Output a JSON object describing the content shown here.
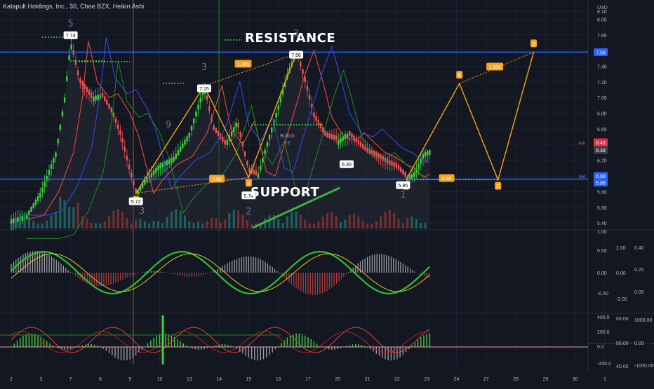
{
  "header": {
    "title": "Katapult Holdings, Inc., 30, Cboe BZX, Heikin Ashi",
    "currency": "USD"
  },
  "annotations": {
    "resistance": "RESISTANCE",
    "support": "SUPPORT",
    "bullish": "Bullish",
    "bullish_score": "+2"
  },
  "colors": {
    "background": "#131722",
    "up": "#26a69a",
    "green": "#3cd23c",
    "down": "#ef5350",
    "level_line": "#2962ff",
    "pattern": "#f7a21b",
    "grid": "#1e2230"
  },
  "chart_data": [
    {
      "type": "line",
      "name": "price",
      "style": "heikin_ashi_candles",
      "x_ticks": [
        "2",
        "3",
        "7",
        "8",
        "9",
        "10",
        "13",
        "14",
        "15",
        "16",
        "17",
        "20",
        "21",
        "22",
        "23",
        "24",
        "27",
        "28",
        "29",
        "30",
        "1"
      ],
      "y_ticks": [
        "8.10",
        "8.00",
        "7.80",
        "7.60",
        "7.40",
        "7.20",
        "7.00",
        "6.80",
        "6.60",
        "6.40",
        "6.20",
        "6.00",
        "5.80",
        "5.60",
        "5.40"
      ],
      "ylim": [
        5.33,
        8.12
      ],
      "price_markers": {
        "resistance": "7.58",
        "ask_label": "Ask",
        "ask": "6.43",
        "last": "6.33",
        "bid_label": "Bid",
        "bid": "6.00",
        "support": "5.95"
      },
      "levels": {
        "resistance": 7.58,
        "support": 5.96
      },
      "close_path": [
        [
          0.0,
          5.45
        ],
        [
          0.5,
          5.5
        ],
        [
          1.0,
          5.8
        ],
        [
          1.5,
          6.3
        ],
        [
          1.8,
          7.0
        ],
        [
          2.0,
          7.72
        ],
        [
          2.3,
          7.2
        ],
        [
          2.7,
          7.0
        ],
        [
          3.0,
          7.05
        ],
        [
          3.4,
          6.8
        ],
        [
          3.7,
          6.5
        ],
        [
          4.0,
          6.05
        ],
        [
          4.2,
          5.78
        ],
        [
          4.5,
          5.95
        ],
        [
          5.0,
          6.15
        ],
        [
          5.5,
          6.25
        ],
        [
          6.0,
          6.55
        ],
        [
          6.5,
          7.15
        ],
        [
          6.8,
          6.6
        ],
        [
          7.2,
          6.4
        ],
        [
          7.6,
          6.7
        ],
        [
          8.0,
          6.05
        ],
        [
          8.3,
          6.0
        ],
        [
          8.6,
          6.4
        ],
        [
          9.0,
          6.9
        ],
        [
          9.3,
          7.3
        ],
        [
          9.6,
          7.6
        ],
        [
          9.9,
          7.2
        ],
        [
          10.2,
          6.75
        ],
        [
          10.6,
          6.5
        ],
        [
          11.0,
          6.45
        ],
        [
          11.3,
          6.55
        ],
        [
          11.7,
          6.4
        ],
        [
          12.0,
          6.3
        ],
        [
          12.3,
          6.25
        ],
        [
          12.7,
          6.15
        ],
        [
          13.0,
          6.1
        ],
        [
          13.3,
          5.98
        ],
        [
          13.6,
          6.05
        ],
        [
          13.9,
          6.3
        ],
        [
          14.1,
          6.33
        ]
      ],
      "pattern_ab": {
        "points": [
          [
            4.2,
            5.78
          ],
          [
            6.5,
            7.15
          ],
          [
            8.0,
            5.98
          ],
          [
            9.6,
            7.56
          ]
        ],
        "labels": [
          "A",
          "",
          "B",
          ""
        ],
        "ratios": [
          "0.89",
          "1.365"
        ]
      },
      "pattern_projection": {
        "points": [
          [
            13.3,
            5.95
          ],
          [
            15.1,
            7.18
          ],
          [
            16.4,
            5.95
          ],
          [
            17.6,
            7.58
          ]
        ],
        "labels": [
          "A",
          "B",
          "C",
          "D"
        ],
        "ratios": [
          "0.98",
          "1.365"
        ]
      },
      "price_tags": [
        "7.74",
        "7.56",
        "7.15",
        "6.30",
        "5.85",
        "5.72",
        "5.74"
      ],
      "count_labels": [
        "5",
        "3",
        "3",
        "2",
        "3",
        "1",
        "9"
      ]
    },
    {
      "type": "area",
      "name": "oscillator-1",
      "y_ticks_right": [
        "0.50",
        "0.00",
        "-0.50"
      ],
      "y_ticks_right2": [
        "2.00",
        "0.00",
        "-2.00"
      ],
      "y_ticks_right3": [
        "0.40",
        "0.20",
        "0.00"
      ],
      "ylim": [
        -0.8,
        0.8
      ]
    },
    {
      "type": "line",
      "name": "oscillator-2",
      "y_ticks_left": [
        "400.0",
        "200.0",
        "0.0",
        "-200.0"
      ],
      "y_ticks_mid": [
        "60.00",
        "50.00",
        "40.00"
      ],
      "y_ticks_right": [
        "1000.00",
        "0.00",
        "-1000.00"
      ],
      "side_value": "1.00"
    }
  ]
}
